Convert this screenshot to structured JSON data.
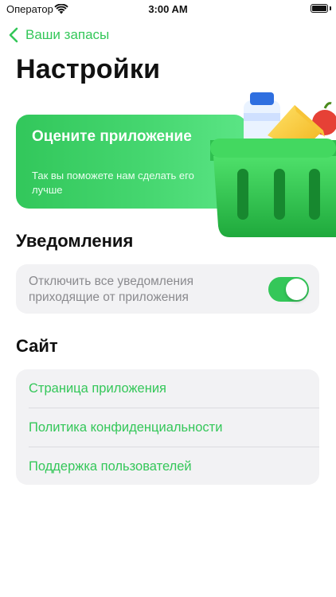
{
  "status_bar": {
    "carrier": "Оператор",
    "time": "3:00 AM"
  },
  "nav": {
    "back_label": "Ваши запасы"
  },
  "page": {
    "title": "Настройки"
  },
  "rate_card": {
    "title": "Оцените приложение",
    "subtitle": "Так вы поможете нам сделать его лучше"
  },
  "notifications": {
    "section_title": "Уведомления",
    "toggle_label": "Отключить все уведомления приходящие от приложения",
    "toggle_on": true
  },
  "site": {
    "section_title": "Сайт",
    "items": [
      {
        "label": "Страница приложения"
      },
      {
        "label": "Политика конфиденциальности"
      },
      {
        "label": "Поддержка пользователей"
      }
    ]
  },
  "colors": {
    "accent": "#34c759",
    "card_bg": "#f2f2f4"
  }
}
